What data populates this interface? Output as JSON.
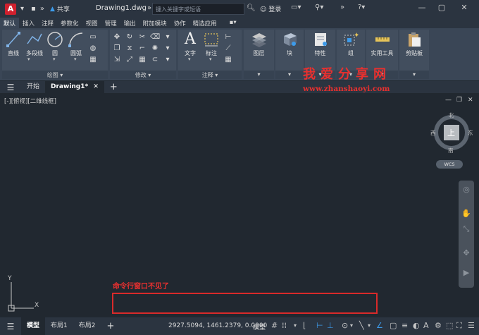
{
  "titlebar": {
    "app_logo": "A",
    "share_label": "共享",
    "doc_title": "Drawing1.dwg",
    "search_placeholder": "键入关键字或短语",
    "login_label": "登录"
  },
  "ribbon_tabs": [
    "默认",
    "插入",
    "注释",
    "参数化",
    "视图",
    "管理",
    "输出",
    "附加模块",
    "协作",
    "精选应用"
  ],
  "ribbon": {
    "draw": {
      "label": "绘图",
      "line": "直线",
      "polyline": "多段线",
      "circle": "圆",
      "arc": "圆弧"
    },
    "modify": {
      "label": "修改"
    },
    "annotation": {
      "label": "注释",
      "text": "文字",
      "dimension": "标注"
    },
    "layers": {
      "label": "图层"
    },
    "block": {
      "label": "块"
    },
    "properties": {
      "label": "特性"
    },
    "groups": {
      "label": "组"
    },
    "utilities": {
      "label": "实用工具"
    },
    "clipboard": {
      "label": "剪贴板"
    }
  },
  "file_tabs": {
    "start": "开始",
    "drawing": "Drawing1*"
  },
  "viewport": {
    "label": "[-][俯视][二维线框]",
    "viewcube": {
      "top": "上",
      "north": "北",
      "south": "南",
      "east": "东",
      "west": "西",
      "wcs": "WCS"
    }
  },
  "annotation_text": "命令行窗口不见了",
  "ucs": {
    "x": "X",
    "y": "Y"
  },
  "watermark": {
    "title": "我爱分享网",
    "url": "www.zhanshaoyi.com"
  },
  "statusbar": {
    "tabs": [
      "模型",
      "布局1",
      "布局2"
    ],
    "coordinates": "2927.5094, 1461.2379, 0.0000",
    "model_label": "模型"
  },
  "colors": {
    "accent": "#3d9bea",
    "annotation": "#e8302f",
    "logo": "#d0202e"
  }
}
